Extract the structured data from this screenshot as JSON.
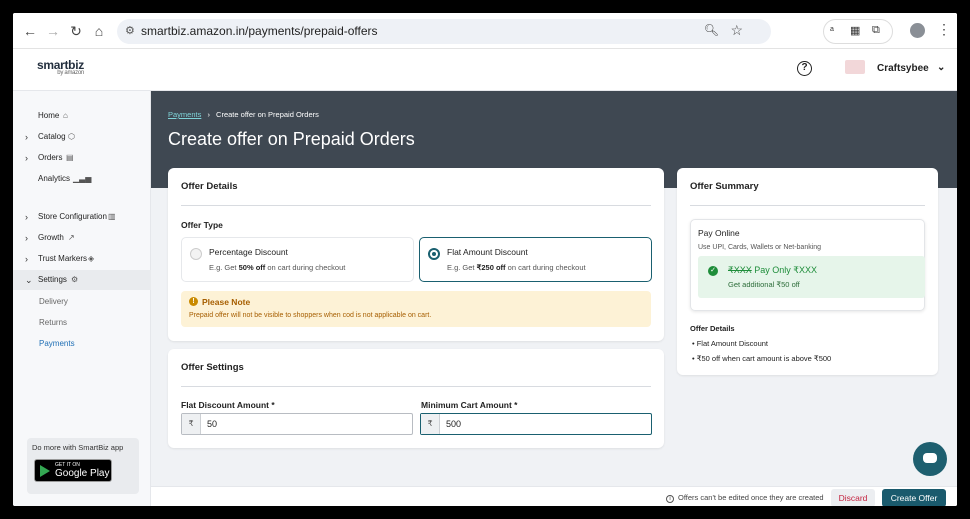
{
  "browser": {
    "url": "smartbiz.amazon.in/payments/prepaid-offers",
    "nav_back": "←",
    "nav_forward": "→",
    "nav_reload": "↻",
    "nav_home": "⌂"
  },
  "app": {
    "logo": "smartbiz",
    "logo_sub": "by amazon",
    "help": "?",
    "account_name": "Craftsybee"
  },
  "sidebar": {
    "items": [
      {
        "label": "Home"
      },
      {
        "label": "Catalog"
      },
      {
        "label": "Orders"
      },
      {
        "label": "Analytics"
      },
      {
        "label": "Store Configuration"
      },
      {
        "label": "Growth"
      },
      {
        "label": "Trust Markers"
      },
      {
        "label": "Settings"
      }
    ],
    "sub_items": [
      {
        "label": "Delivery"
      },
      {
        "label": "Returns"
      },
      {
        "label": "Payments"
      }
    ],
    "promo_text": "Do more with SmartBiz app",
    "gplay_small": "GET IT ON",
    "gplay_big": "Google Play"
  },
  "page": {
    "breadcrumb_link": "Payments",
    "breadcrumb_sep": "›",
    "breadcrumb_current": "Create offer on Prepaid Orders",
    "title": "Create offer on Prepaid Orders"
  },
  "offer_details": {
    "title": "Offer Details",
    "type_label": "Offer Type",
    "options": [
      {
        "title": "Percentage Discount",
        "desc_pre": "E.g. Get ",
        "desc_bold": "50% off",
        "desc_post": " on cart during checkout"
      },
      {
        "title": "Flat Amount Discount",
        "desc_pre": "E.g. Get ",
        "desc_bold": "₹250 off",
        "desc_post": " on cart during checkout"
      }
    ],
    "note_title": "Please Note",
    "note_body": "Prepaid offer will not be visible to shoppers when cod is not applicable on cart."
  },
  "offer_settings": {
    "title": "Offer Settings",
    "flat_label": "Flat Discount Amount *",
    "flat_currency": "₹",
    "flat_value": "50",
    "min_label": "Minimum Cart Amount *",
    "min_currency": "₹",
    "min_value": "500"
  },
  "summary": {
    "title": "Offer Summary",
    "pay_title": "Pay Online",
    "pay_sub": "Use UPI, Cards, Wallets or Net-banking",
    "strike": "₹XXX",
    "pay_only": "Pay Only ₹XXX",
    "additional": "Get additional ₹50 off",
    "details_title": "Offer Details",
    "bullets": [
      "Flat Amount Discount",
      "₹50 off when cart amount is above ₹500"
    ]
  },
  "footer": {
    "info": "Offers can't be edited once they are created",
    "discard": "Discard",
    "create": "Create Offer"
  },
  "colors": {
    "primary": "#1a5a6d",
    "banner": "#3f4852",
    "success": "#1e8d3a",
    "warning_bg": "#fdf2d6",
    "danger": "#c4223f"
  }
}
